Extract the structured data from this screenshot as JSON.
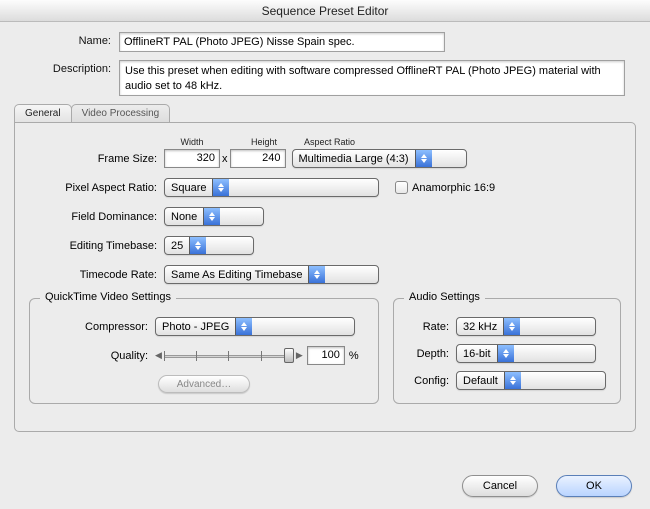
{
  "window": {
    "title": "Sequence Preset Editor"
  },
  "header": {
    "name_label": "Name:",
    "name_value": "OfflineRT PAL (Photo JPEG) Nisse Spain spec.",
    "description_label": "Description:",
    "description_value": "Use this preset when editing with software compressed OfflineRT PAL (Photo JPEG) material with audio set to 48 kHz."
  },
  "tabs": {
    "general": "General",
    "video_processing": "Video Processing"
  },
  "general": {
    "frame_size_label": "Frame Size:",
    "width_label": "Width",
    "height_label": "Height",
    "aspect_label": "Aspect Ratio",
    "width": "320",
    "height": "240",
    "x": "x",
    "aspect_value": "Multimedia Large (4:3)",
    "pixel_aspect_label": "Pixel Aspect Ratio:",
    "pixel_aspect_value": "Square",
    "anamorphic_label": "Anamorphic 16:9",
    "field_dom_label": "Field Dominance:",
    "field_dom_value": "None",
    "timebase_label": "Editing Timebase:",
    "timebase_value": "25",
    "timecode_label": "Timecode Rate:",
    "timecode_value": "Same As Editing Timebase"
  },
  "qt": {
    "title": "QuickTime Video Settings",
    "compressor_label": "Compressor:",
    "compressor_value": "Photo - JPEG",
    "quality_label": "Quality:",
    "quality_value": "100",
    "quality_unit": "%",
    "advanced": "Advanced…"
  },
  "audio": {
    "title": "Audio Settings",
    "rate_label": "Rate:",
    "rate_value": "32 kHz",
    "depth_label": "Depth:",
    "depth_value": "16-bit",
    "config_label": "Config:",
    "config_value": "Default"
  },
  "buttons": {
    "cancel": "Cancel",
    "ok": "OK"
  }
}
